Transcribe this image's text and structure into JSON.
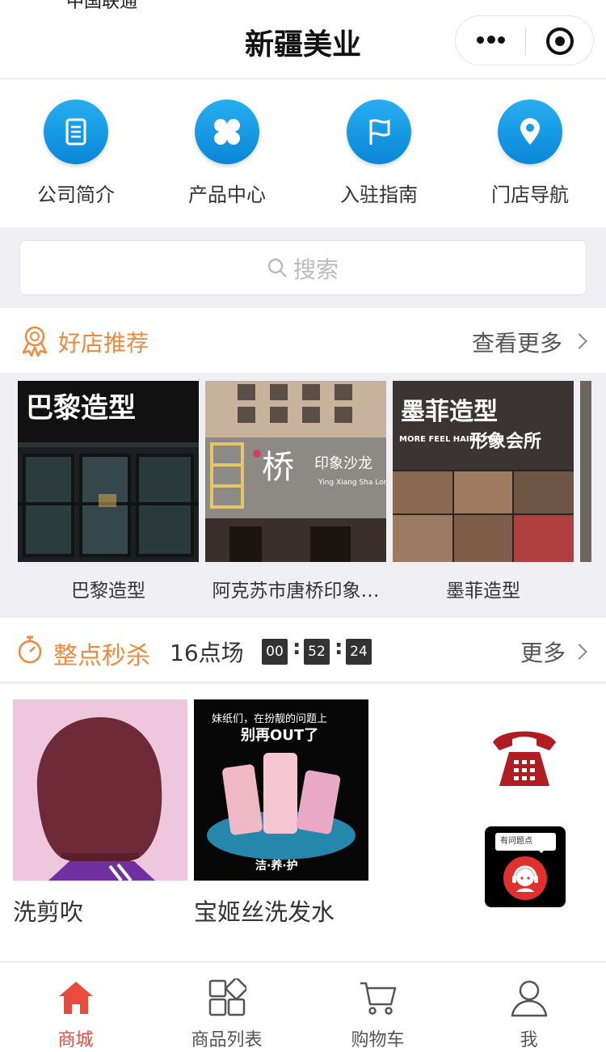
{
  "status_fragment": "中国联通",
  "header": {
    "title": "新疆美业"
  },
  "nav_items": [
    {
      "label": "公司简介",
      "icon": "document-icon"
    },
    {
      "label": "产品中心",
      "icon": "grid-icon"
    },
    {
      "label": "入驻指南",
      "icon": "flag-icon"
    },
    {
      "label": "门店导航",
      "icon": "location-pin-icon"
    }
  ],
  "search": {
    "placeholder": "搜索"
  },
  "shops_section": {
    "title": "好店推荐",
    "more": "查看更多",
    "shops": [
      {
        "name": "巴黎造型",
        "sign": "巴黎造型"
      },
      {
        "name": "阿克苏市唐桥印象…",
        "sign": "桥",
        "sign_sub": "印象沙龙",
        "sign_pinyin": "Ying Xiang Sha Long"
      },
      {
        "name": "墨菲造型",
        "sign": "墨菲造型",
        "sign_en": "MORE FEEL HAIRSTYLE",
        "sign_sub": "形象会所"
      }
    ]
  },
  "flash_sale": {
    "title": "整点秒杀",
    "session": "16点场",
    "time": {
      "h": "00",
      "m": "52",
      "s": "24"
    },
    "more": "更多",
    "products": [
      {
        "name": "洗剪吹"
      },
      {
        "name": "宝姬丝洗发水",
        "poster_top": "妹纸们，在扮靓的问题上",
        "poster_big": "别再OUT了",
        "poster_bottom": "洁·养·护"
      }
    ]
  },
  "chat_float": {
    "bubble": "有问题点"
  },
  "tabbar": [
    {
      "label": "商城",
      "icon": "home-icon",
      "active": true
    },
    {
      "label": "商品列表",
      "icon": "category-icon",
      "active": false
    },
    {
      "label": "购物车",
      "icon": "cart-icon",
      "active": false
    },
    {
      "label": "我",
      "icon": "user-icon",
      "active": false
    }
  ],
  "colors": {
    "accent_orange": "#f1893b",
    "tab_active": "#e94b3c",
    "nav_blue": "#1a9be6",
    "background_gray": "#efeff4"
  }
}
